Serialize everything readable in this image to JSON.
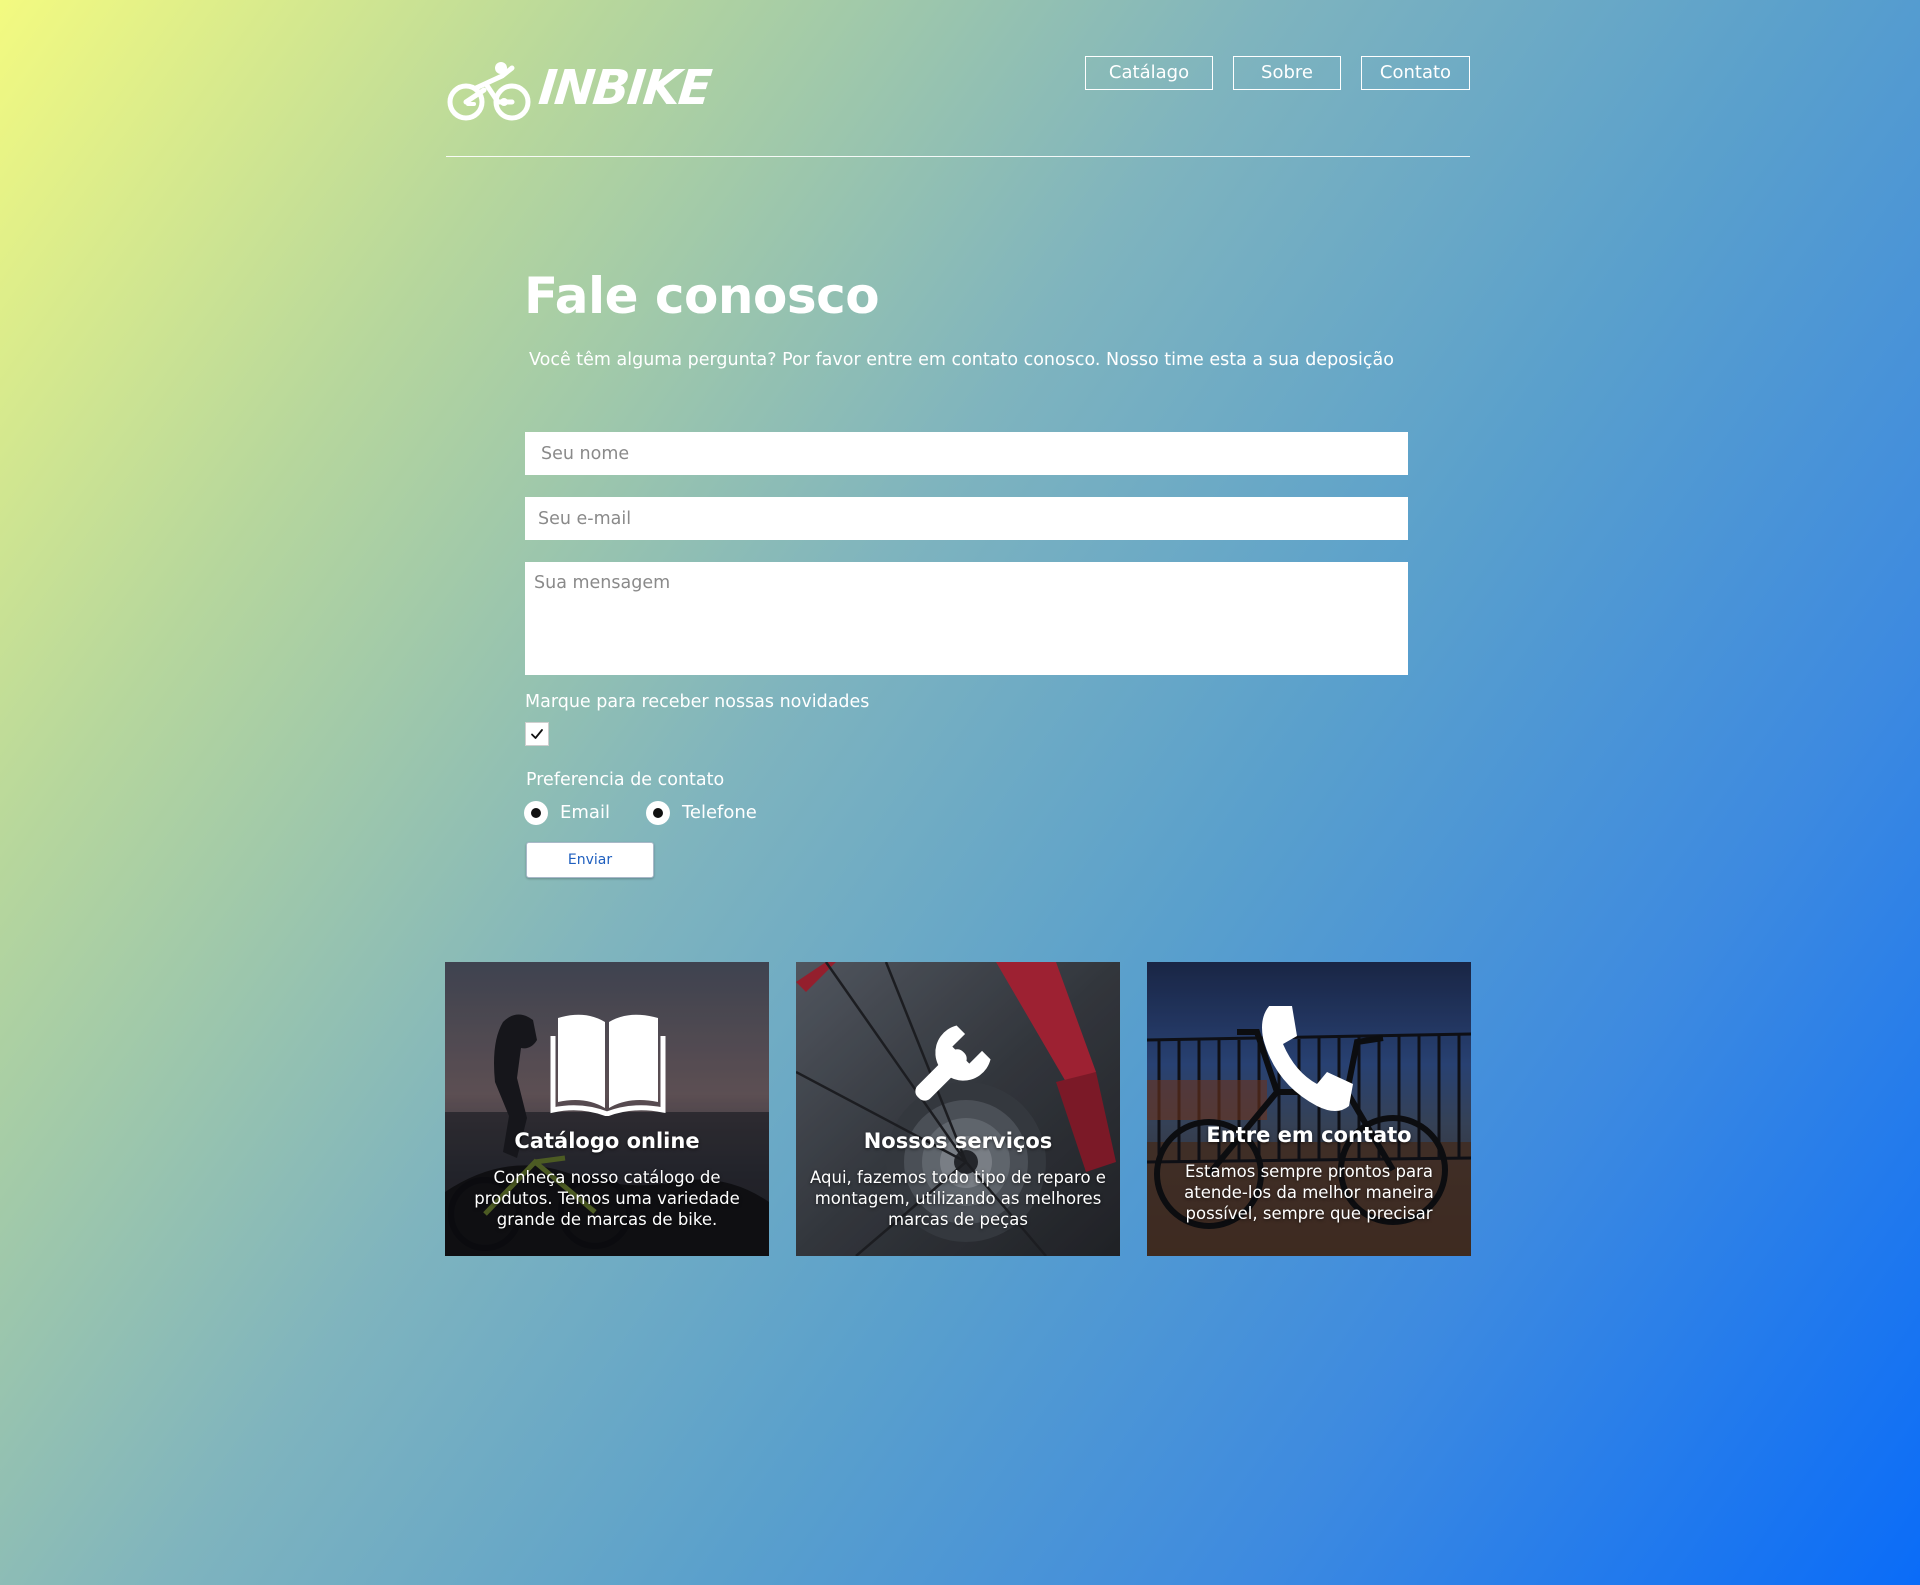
{
  "brand": {
    "name": "INBIKE",
    "logo_icon": "cyclist-icon"
  },
  "nav": {
    "items": [
      {
        "label": "Catálago"
      },
      {
        "label": "Sobre"
      },
      {
        "label": "Contato"
      }
    ]
  },
  "contact": {
    "title": "Fale conosco",
    "subtitle": "Você têm alguma pergunta? Por favor entre em contato conosco. Nosso time esta a sua deposição",
    "name_placeholder": "Seu nome",
    "email_placeholder": "Seu e-mail",
    "message_placeholder": "Sua mensagem",
    "newsletter_label": "Marque para receber nossas novidades",
    "newsletter_checked": true,
    "preference_label": "Preferencia de contato",
    "preference_options": [
      {
        "label": "Email",
        "selected": true
      },
      {
        "label": "Telefone",
        "selected": true
      }
    ],
    "submit_label": "Enviar"
  },
  "cards": [
    {
      "icon": "book-icon",
      "title": "Catálogo online",
      "text": "Conheça nosso catálogo de produtos. Temos uma variedade grande de marcas de bike."
    },
    {
      "icon": "wrench-icon",
      "title": "Nossos serviços",
      "text": "Aqui, fazemos todo tipo de reparo e montagem, utilizando as melhores marcas de peças"
    },
    {
      "icon": "phone-icon",
      "title": "Entre em contato",
      "text": "Estamos sempre prontos para atende-los da melhor maneira possível, sempre que precisar"
    }
  ],
  "colors": {
    "gradient_start": "#f3fa80",
    "gradient_end": "#0a6cf8",
    "text": "#ffffff",
    "button_text": "#1f5fbf"
  }
}
